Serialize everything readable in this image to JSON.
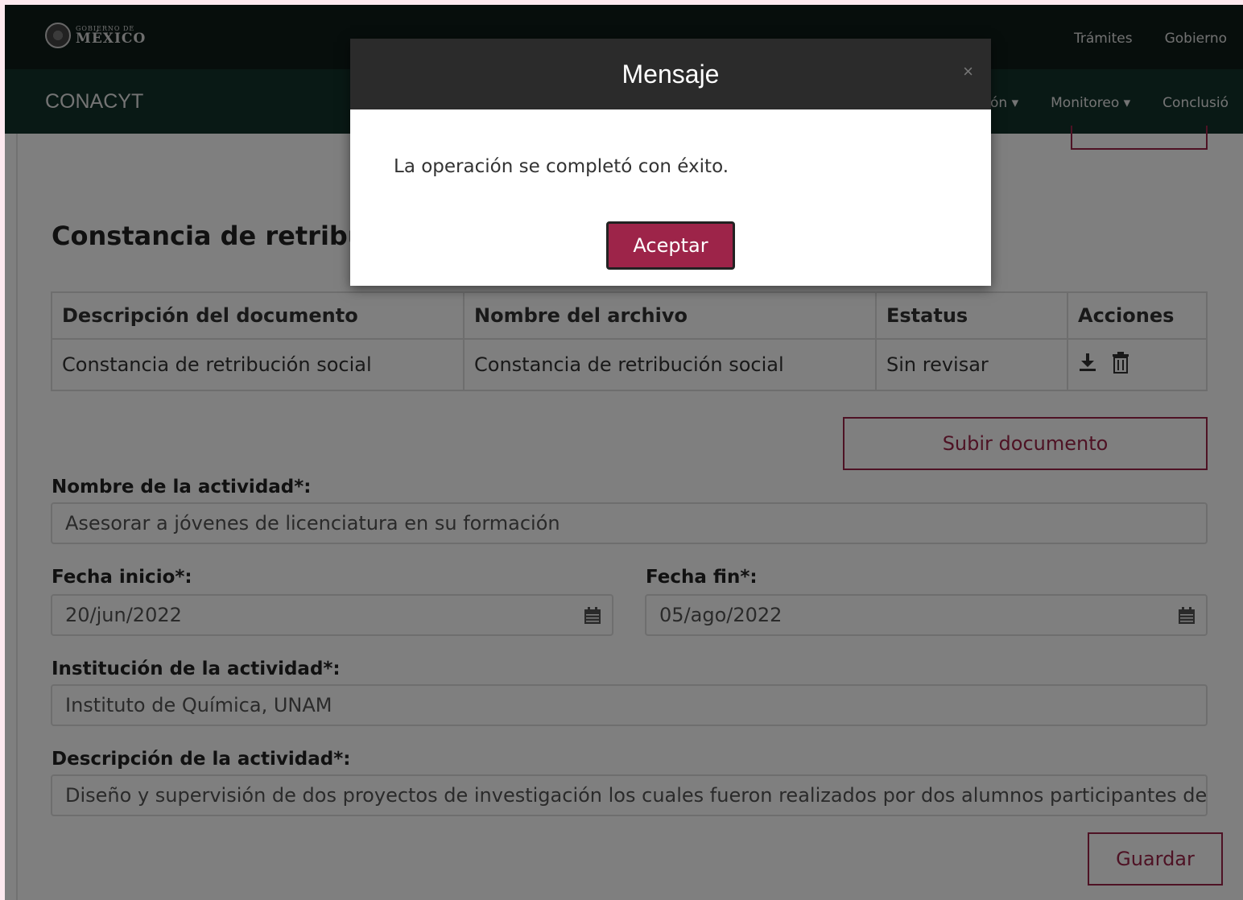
{
  "govbar": {
    "logo_small": "GOBIERNO DE",
    "logo_big": "MÉXICO",
    "links": [
      "Trámites",
      "Gobierno"
    ]
  },
  "appnav": {
    "brand": "CONACYT",
    "items": [
      "ón ▾",
      "Monitoreo ▾",
      "Conclusió"
    ]
  },
  "section": {
    "title": "Constancia de retribución social"
  },
  "table": {
    "headers": [
      "Descripción del documento",
      "Nombre del archivo",
      "Estatus",
      "Acciones"
    ],
    "rows": [
      [
        "Constancia de retribución social",
        "Constancia de retribución social",
        "Sin revisar"
      ]
    ]
  },
  "upload_label": "Subir documento",
  "form": {
    "activity_name_label": "Nombre de la actividad*:",
    "activity_name_value": "Asesorar a jóvenes de licenciatura en su formación",
    "start_label": "Fecha inicio*:",
    "start_value": "20/jun/2022",
    "end_label": "Fecha fin*:",
    "end_value": "05/ago/2022",
    "institution_label": "Institución de la actividad*:",
    "institution_value": "Instituto de Química, UNAM",
    "description_label": "Descripción de la actividad*:",
    "description_value": "Diseño y supervisión de dos proyectos de investigación los cuales fueron realizados por dos alumnos participantes de"
  },
  "save_label": "Guardar",
  "modal": {
    "title": "Mensaje",
    "close": "×",
    "message": "La operación se completó con éxito.",
    "accept": "Aceptar"
  },
  "colors": {
    "brand_dark": "#13322b",
    "accent": "#9d2449"
  },
  "icons": [
    "download-icon",
    "trash-icon",
    "calendar-icon",
    "close-icon"
  ]
}
